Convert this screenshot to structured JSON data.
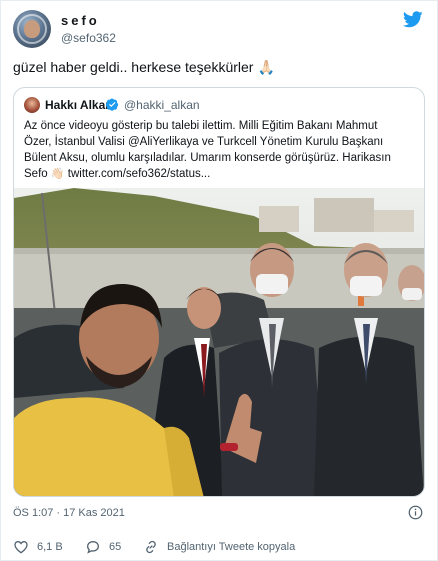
{
  "author": {
    "name": "sefo",
    "handle": "@sefo362"
  },
  "tweet": {
    "text": "güzel haber geldi.. herkese teşekkürler",
    "emoji": "🙏🏻"
  },
  "quoted": {
    "name": "Hakkı Alkan",
    "handle": "@hakki_alkan",
    "lines": [
      "Az önce videoyu gösterip bu talebi ilettim. Milli Eğitim Bakanı Mahmut",
      "Özer, İstanbul Valisi @AliYerlikaya ve Turkcell Yönetim Kurulu Başkanı",
      "Bülent Aksu, olumlu karşıladılar. Umarım konserde görüşürüz. Harikasın"
    ],
    "last_line_start": "Sefo",
    "wave_emoji": "👋🏻",
    "last_line_link": "twitter.com/sefo362/status..."
  },
  "meta": {
    "timestamp": "ÖS 1:07 · 17 Kas 2021"
  },
  "actions": {
    "likes": "6,1 B",
    "replies": "65",
    "copy_link": "Bağlantıyı Tweete kopyala"
  },
  "colors": {
    "brand": "#1d9bf0",
    "like": "#f91880",
    "secondary_text": "#536471"
  },
  "icons": [
    "twitter-bird-icon",
    "verified-icon",
    "info-icon",
    "heart-icon",
    "reply-icon",
    "link-icon"
  ]
}
